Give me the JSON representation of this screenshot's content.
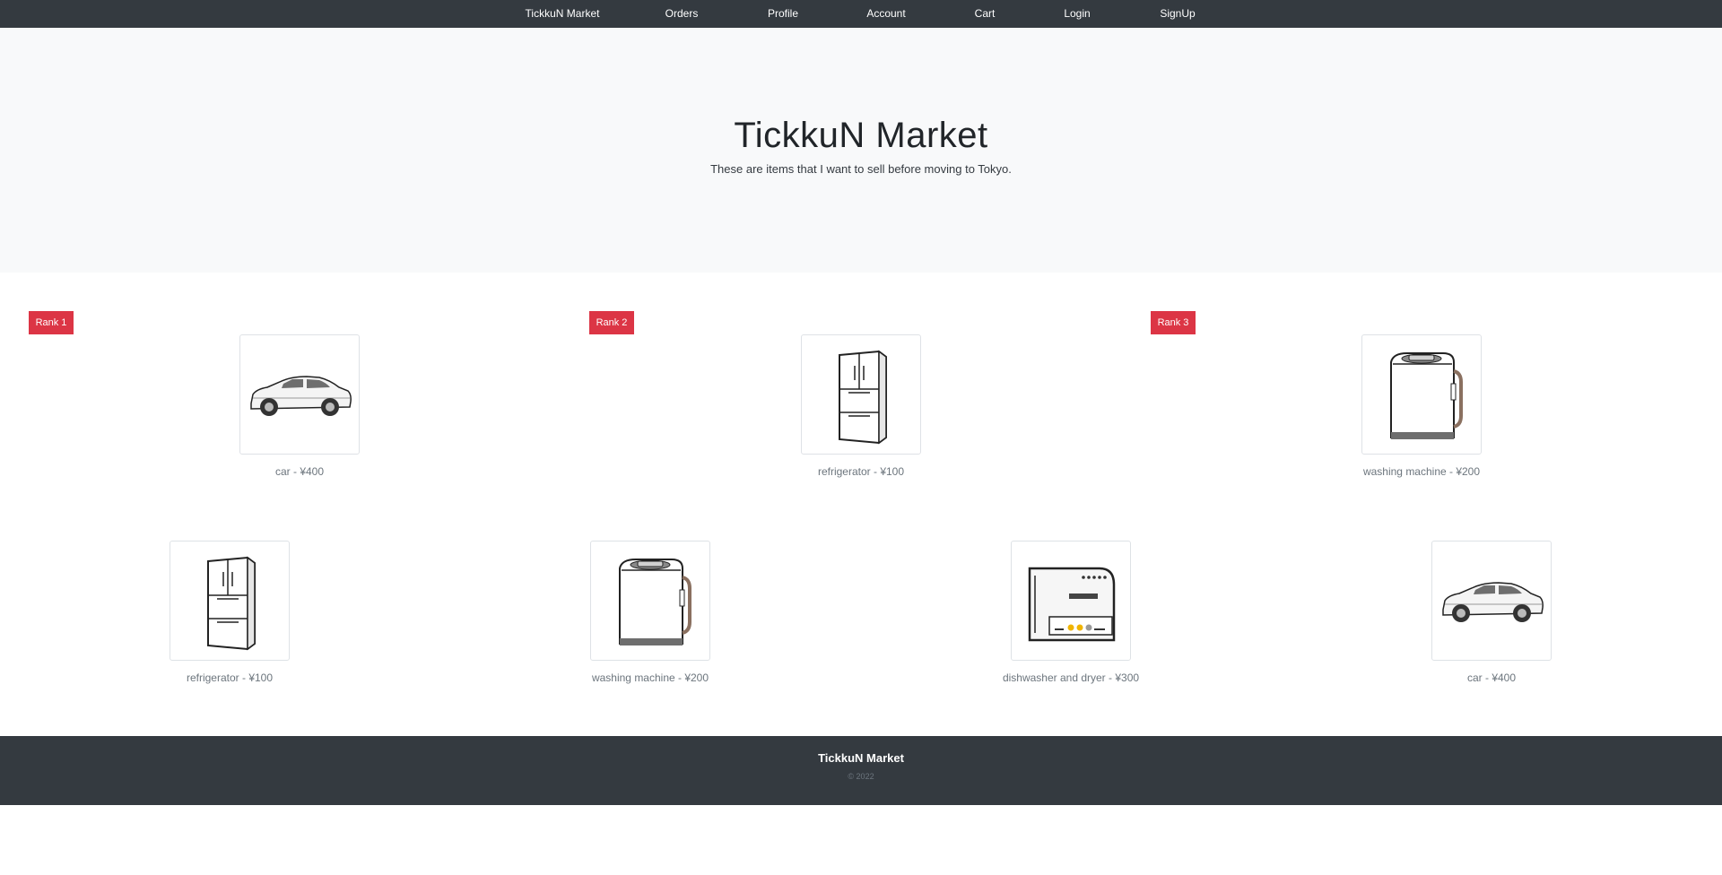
{
  "nav": {
    "brand": "TickkuN Market",
    "items": [
      "Orders",
      "Profile",
      "Account",
      "Cart",
      "Login",
      "SignUp"
    ]
  },
  "hero": {
    "title": "TickkuN Market",
    "subtitle": "These are items that I want to sell before moving to Tokyo."
  },
  "ranking": [
    {
      "badge": "Rank 1",
      "icon": "car-icon",
      "caption": "car - ¥400"
    },
    {
      "badge": "Rank 2",
      "icon": "refrigerator-icon",
      "caption": "refrigerator - ¥100"
    },
    {
      "badge": "Rank 3",
      "icon": "washing-machine-icon",
      "caption": "washing machine - ¥200"
    }
  ],
  "items": [
    {
      "icon": "refrigerator-icon",
      "caption": "refrigerator - ¥100"
    },
    {
      "icon": "washing-machine-icon",
      "caption": "washing machine - ¥200"
    },
    {
      "icon": "dishwasher-icon",
      "caption": "dishwasher and dryer - ¥300"
    },
    {
      "icon": "car-icon",
      "caption": "car - ¥400"
    }
  ],
  "footer": {
    "title": "TickkuN Market",
    "copyright": "© 2022"
  },
  "colors": {
    "navbar": "#343a40",
    "hero_bg": "#f8f9fa",
    "rank_badge": "#dc3545",
    "footer": "#343a40"
  }
}
